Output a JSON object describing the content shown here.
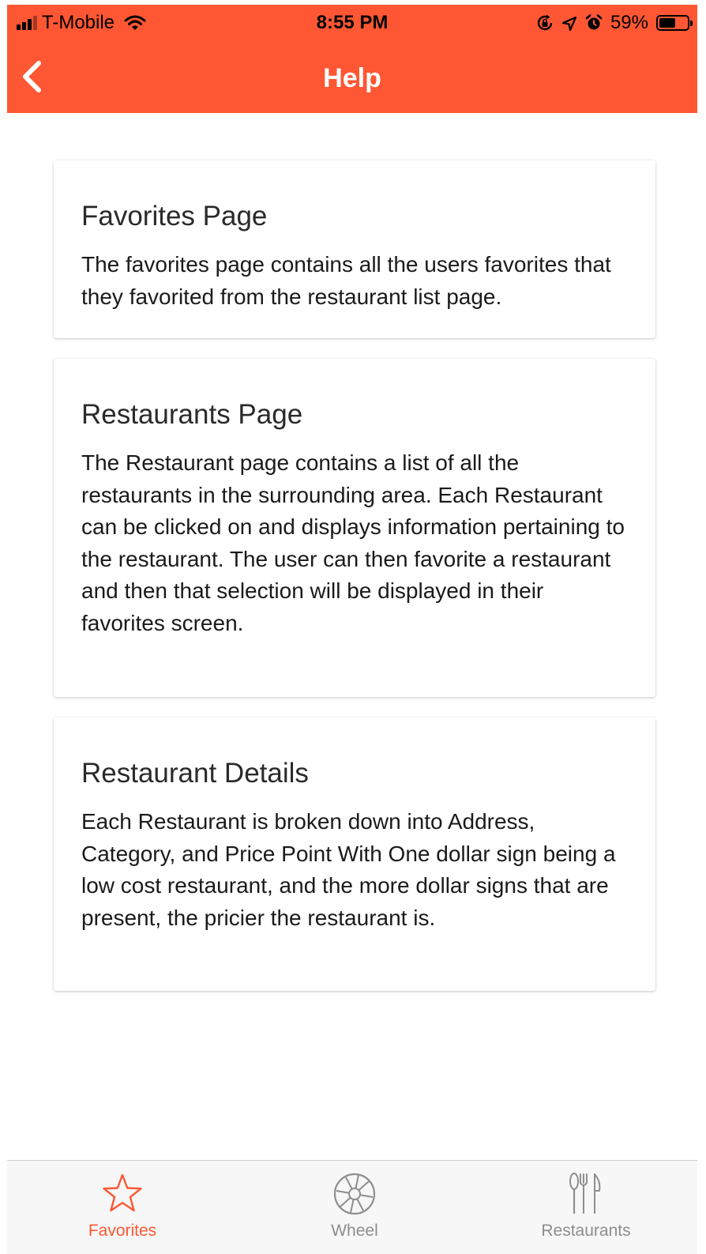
{
  "status_bar": {
    "carrier": "T-Mobile",
    "time": "8:55 PM",
    "battery_percent": "59%",
    "battery_level": 0.59,
    "icons": [
      "signal-icon",
      "wifi-icon",
      "rotation-lock-icon",
      "location-icon",
      "alarm-icon",
      "battery-icon"
    ]
  },
  "nav": {
    "title": "Help",
    "back_icon": "chevron-left-icon"
  },
  "colors": {
    "accent": "#FF5733",
    "inactive_tab": "#8e8e8e"
  },
  "cards": [
    {
      "title": "Favorites Page",
      "body": "The favorites page contains all the users favorites that they favorited from the restaurant list page."
    },
    {
      "title": "Restaurants Page",
      "body": "The Restaurant page contains a list of all the restaurants in the surrounding area. Each Restaurant can be clicked on and displays information pertaining to the restaurant. The user can then favorite a restaurant and then that selection will be displayed in their favorites screen."
    },
    {
      "title": "Restaurant Details",
      "body": "Each Restaurant is broken down into Address, Category, and Price Point With One dollar sign being a low cost restaurant, and the more dollar signs that are present, the pricier the restaurant is."
    }
  ],
  "tab_bar": {
    "tabs": [
      {
        "label": "Favorites",
        "icon": "star-icon",
        "active": true
      },
      {
        "label": "Wheel",
        "icon": "wheel-icon",
        "active": false
      },
      {
        "label": "Restaurants",
        "icon": "utensils-icon",
        "active": false
      }
    ]
  }
}
